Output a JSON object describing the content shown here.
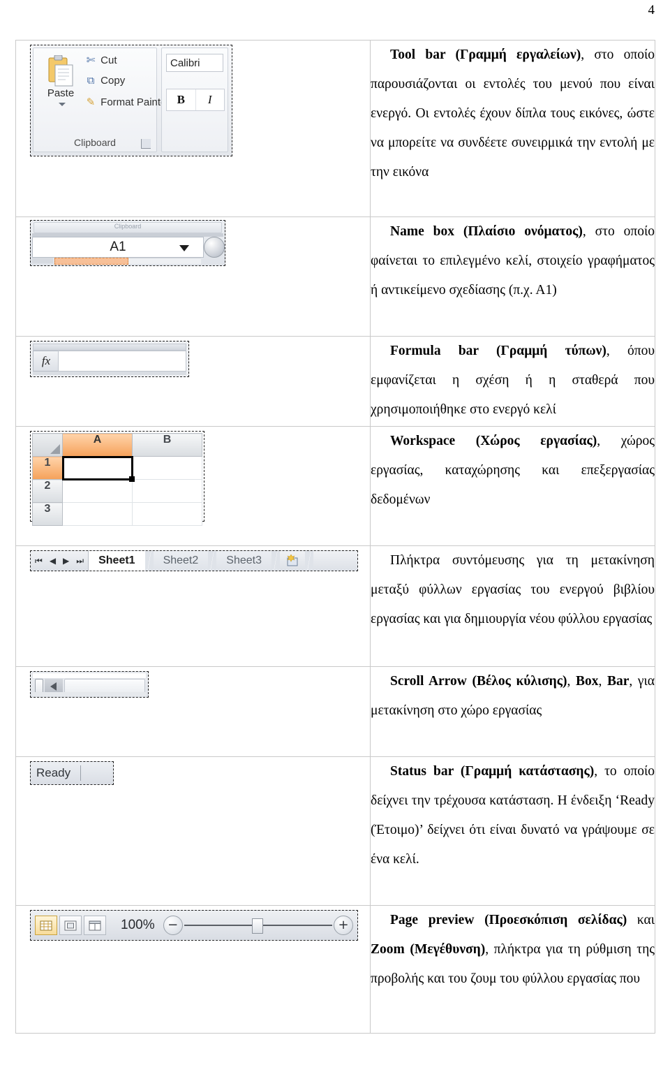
{
  "page": {
    "number": "4"
  },
  "rows": [
    {
      "image": {
        "name": "excel-ribbon-clipboard-font",
        "paste_label": "Paste",
        "commands": [
          {
            "icon": "scissors-icon",
            "glyph": "✂",
            "label": "Cut"
          },
          {
            "icon": "copy-icon",
            "glyph": "⧉",
            "label": "Copy"
          },
          {
            "icon": "paintbrush-icon",
            "glyph": "✎",
            "label": "Format Painter"
          }
        ],
        "group_label": "Clipboard",
        "font_name": "Calibri",
        "bold_label": "B",
        "italic_label": "I"
      },
      "text": [
        {
          "bold": "Tool bar (Γραμμή εργαλείων)",
          "rest": ", στο οποίο παρουσιάζονται οι εντολές του μενού που είναι ενεργό.  Οι εντολές έχουν δίπλα τους εικόνες, ώστε να μπορείτε να συνδέετε συνειρμικά την εντολή με την εικόνα"
        }
      ]
    },
    {
      "image": {
        "name": "excel-name-box",
        "cell_reference": "A1",
        "top_strip_text": "Clipboard"
      },
      "text": [
        {
          "bold": "Name box (Πλαίσιο ονόματος)",
          "rest": ", στο οποίο φαίνεται το επιλεγμένο κελί, στοιχείο γραφήματος ή αντικείμενο σχεδίασης (π.χ. Α1)"
        }
      ]
    },
    {
      "image": {
        "name": "excel-formula-bar",
        "fx_label": "fx",
        "input_value": ""
      },
      "text": [
        {
          "bold": "Formula bar (Γραμμή τύπων)",
          "rest": ", όπου εμφανίζεται η σχέση ή η σταθερά που χρησιμοποιήθηκε στο ενεργό κελί"
        }
      ]
    },
    {
      "image": {
        "name": "excel-worksheet-grid",
        "columns": [
          "A",
          "B"
        ],
        "rows": [
          "1",
          "2",
          "3"
        ],
        "selected_cell": "A1"
      },
      "text": [
        {
          "bold": "Workspace (Χώρος εργασίας)",
          "rest": ", χώρος εργασίας, καταχώρησης και επεξεργασίας δεδομένων"
        }
      ]
    },
    {
      "image": {
        "name": "excel-sheet-tabs",
        "nav_buttons": [
          "⏮",
          "◀",
          "▶",
          "⏭"
        ],
        "tabs": [
          "Sheet1",
          "Sheet2",
          "Sheet3"
        ],
        "active_tab": "Sheet1",
        "new_sheet_icon": "new-sheet-icon"
      },
      "text": [
        {
          "bold": "",
          "rest": "Πλήκτρα συντόμευσης για τη μετακίνηση μεταξύ φύλλων εργασίας του ενεργού βιβλίου εργασίας και για δημιουργία νέου φύλλου εργασίας"
        }
      ]
    },
    {
      "image": {
        "name": "excel-horizontal-scrollbar",
        "arrow_direction": "left"
      },
      "text": [
        {
          "bold": "Scroll Arrow (Βέλος κύλισης)",
          "bold2": "Box",
          "bold3": "Bar",
          "rest": ", για μετακίνηση στο χώρο εργασίας"
        }
      ]
    },
    {
      "image": {
        "name": "excel-status-bar",
        "status_text": "Ready"
      },
      "text": [
        {
          "bold": "Status bar (Γραμμή κατάστασης)",
          "rest": ", το οποίο δείχνει την τρέχουσα κατάσταση.  Η ένδειξη ‘Ready (Έτοιμο)’ δείχνει ότι είναι δυνατό να γράψουμε σε ένα κελί."
        }
      ]
    },
    {
      "image": {
        "name": "excel-zoom-bar",
        "view_buttons": [
          "normal-view-icon",
          "page-layout-icon",
          "page-break-preview-icon"
        ],
        "zoom_level": "100%",
        "zoom_out_glyph": "−",
        "zoom_in_glyph": "+"
      },
      "text": [
        {
          "bold": "Page preview (Προεσκόπιση σελίδας)",
          "mid": " και ",
          "bold2": "Zoom (Μεγέθυνση)",
          "rest": ", πλήκτρα για τη ρύθμιση της προβολής και του ζουμ του φύλλου εργασίας που"
        }
      ]
    }
  ],
  "text_blocks": {
    "r1": {
      "b": "Tool bar (Γραμμή εργαλείων)",
      "t": ", στο οποίο παρουσιάζονται οι εντολές του μενού που είναι ενεργό.  Οι εντολές έχουν δίπλα τους εικόνες, ώστε να μπορείτε να συνδέετε συνειρμικά την εντολή με την εικόνα"
    },
    "r2": {
      "b": "Name box (Πλαίσιο ονόματος)",
      "t": ", στο οποίο φαίνεται το επιλεγμένο κελί, στοιχείο γραφήματος ή αντικείμενο σχεδίασης (π.χ. Α1)"
    },
    "r3": {
      "b": "Formula bar (Γραμμή τύπων)",
      "t": ", όπου εμφανίζεται η σχέση ή η σταθερά που χρησιμοποιήθηκε στο ενεργό κελί"
    },
    "r4": {
      "b": "Workspace (Χώρος εργασίας)",
      "t": ", χώρος εργασίας, καταχώρησης και επεξεργασίας δεδομένων"
    },
    "r5": {
      "t": "Πλήκτρα συντόμευσης για τη μετακίνηση μεταξύ φύλλων εργασίας του ενεργού βιβλίου εργασίας και για δημιουργία νέου φύλλου εργασίας"
    },
    "r6": {
      "b": "Scroll Arrow (Βέλος κύλισης)",
      "t1": ", ",
      "b2": "Box",
      "t2": ", ",
      "b3": "Bar",
      "t": ", για μετακίνηση στο χώρο εργασίας"
    },
    "r7": {
      "b": "Status bar (Γραμμή κατάστασης)",
      "t": ", το οποίο δείχνει την τρέχουσα κατάσταση.  Η ένδειξη ‘Ready (Έτοιμο)’ δείχνει ότι είναι δυνατό να γράψουμε σε ένα κελί."
    },
    "r8": {
      "b": "Page preview (Προεσκόπιση σελίδας)",
      "t1": " και ",
      "b2": "Zoom (Μεγέθυνση)",
      "t": ", πλήκτρα για τη ρύθμιση της προβολής και του ζουμ του φύλλου εργασίας που"
    }
  }
}
